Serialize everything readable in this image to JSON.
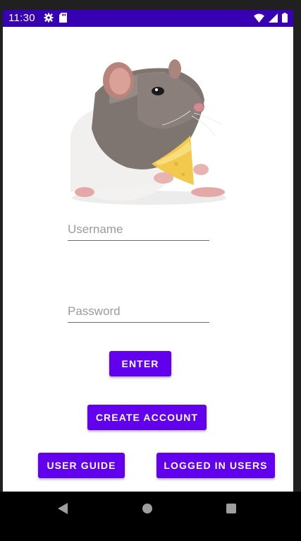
{
  "status_bar": {
    "time": "11:30",
    "left_icons": [
      "settings-gear-icon",
      "sd-card-icon"
    ],
    "right_icons": [
      "wifi-icon",
      "signal-icon",
      "battery-icon"
    ],
    "color": "#3700b3"
  },
  "login_form": {
    "image": "rat-holding-cheese-photo",
    "username": {
      "value": "",
      "placeholder": "Username"
    },
    "password": {
      "value": "",
      "placeholder": "Password"
    },
    "enter_label": "ENTER",
    "create_account_label": "CREATE ACCOUNT",
    "user_guide_label": "USER GUIDE",
    "logged_in_users_label": "LOGGED IN USERS"
  },
  "theme": {
    "button_color": "#6200ee",
    "button_text_color": "#ffffff"
  },
  "nav_bar": {
    "icons": [
      "back-icon",
      "home-icon",
      "recents-icon"
    ]
  }
}
